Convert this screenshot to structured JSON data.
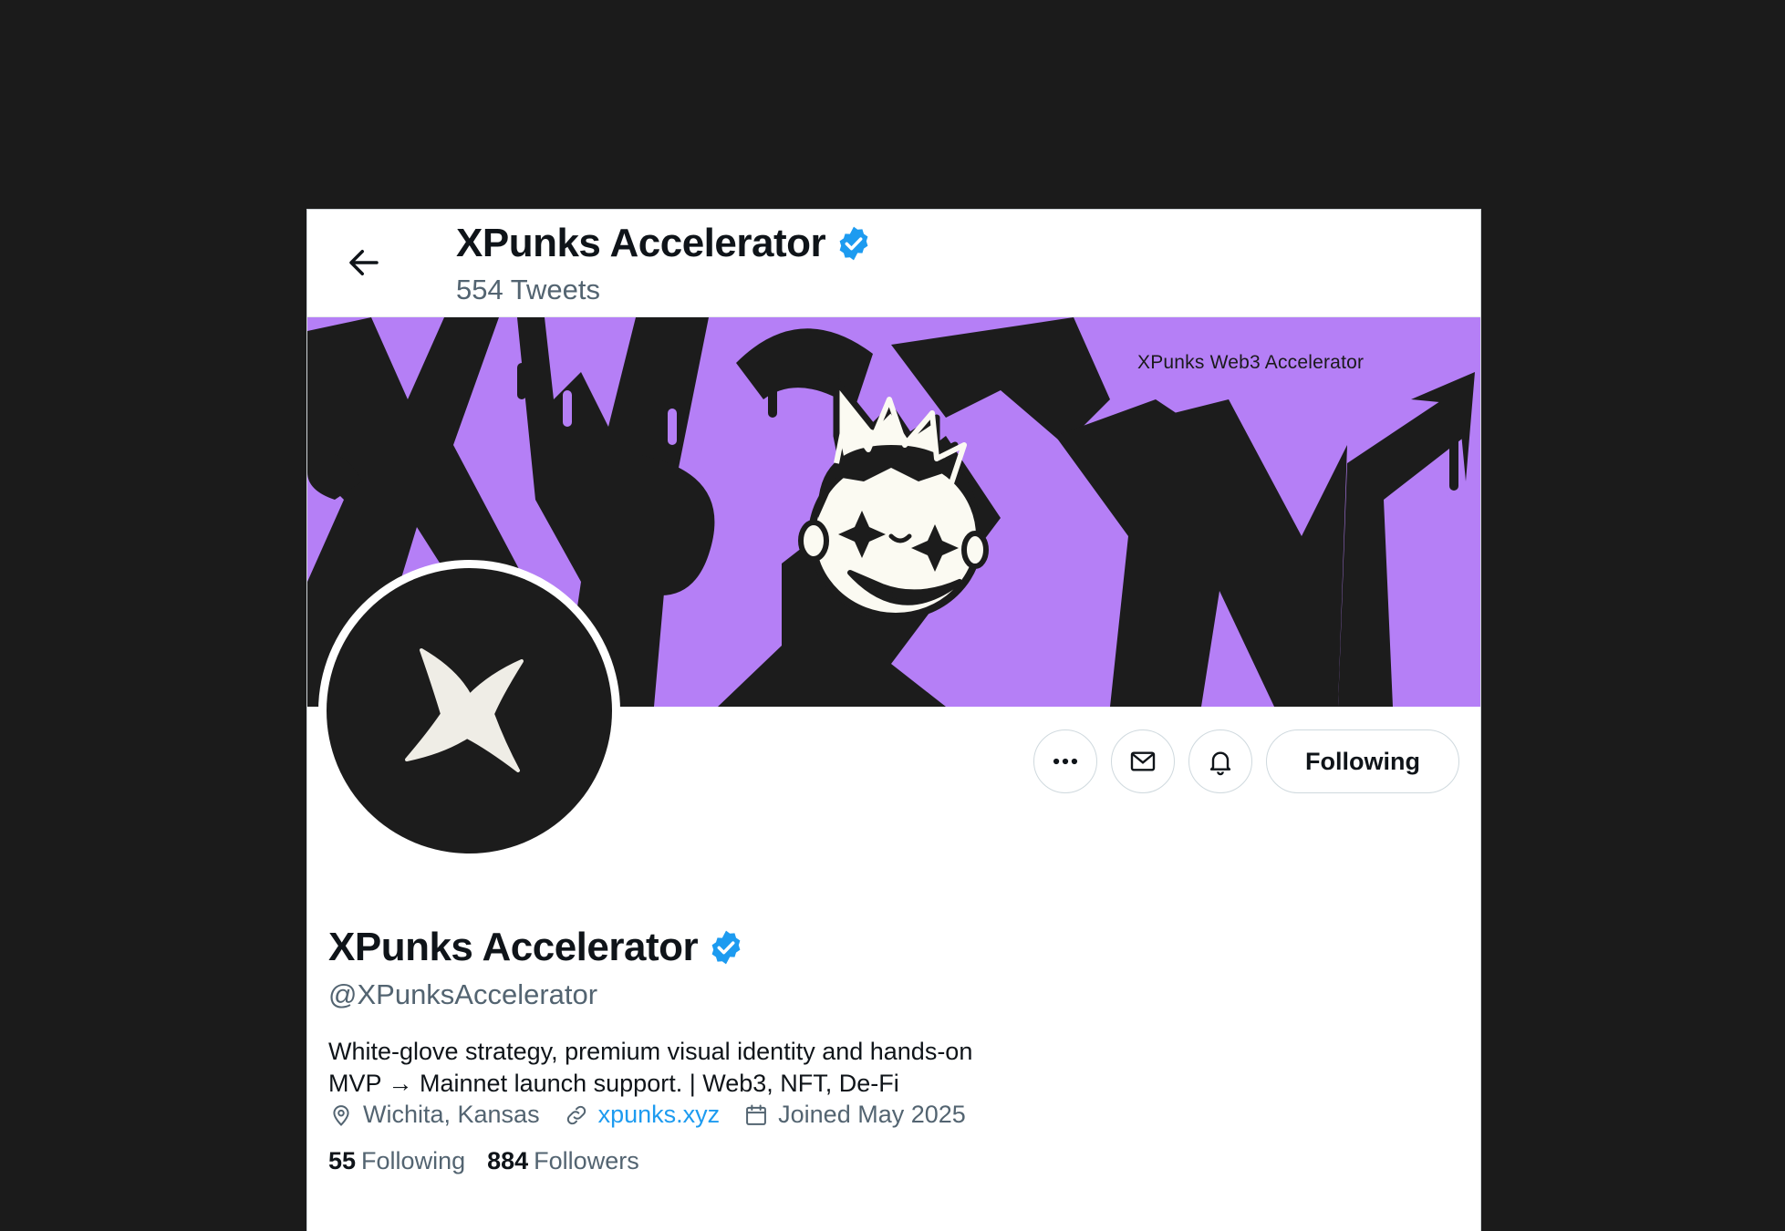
{
  "header": {
    "back_icon": "arrow-left-icon",
    "name": "XPunks Accelerator",
    "verified_icon": "verified-badge-icon",
    "tweet_count": "554 Tweets"
  },
  "banner": {
    "caption": "XPunks Web3 Accelerator",
    "background_color": "#b57ff6"
  },
  "avatar": {
    "icon": "four-point-star-icon",
    "background_color": "#1c1c1c"
  },
  "actions": {
    "more_icon": "more-dots-icon",
    "message_icon": "envelope-icon",
    "notify_icon": "bell-icon",
    "follow_label": "Following"
  },
  "profile": {
    "name": "XPunks Accelerator",
    "handle": "@XPunksAccelerator",
    "bio_line1": "White-glove strategy, premium visual identity and hands-on",
    "bio_line2": "MVP → Mainnet launch support. | Web3, NFT, De-Fi",
    "location": "Wichita, Kansas",
    "website": "xpunks.xyz",
    "joined": "Joined May 2025",
    "following_count": "55",
    "following_label": "Following",
    "followers_count": "884",
    "followers_label": "Followers"
  },
  "colors": {
    "accent": "#1d9bf0",
    "verified": "#1d9bf0",
    "page_background": "#1b1b1b"
  }
}
